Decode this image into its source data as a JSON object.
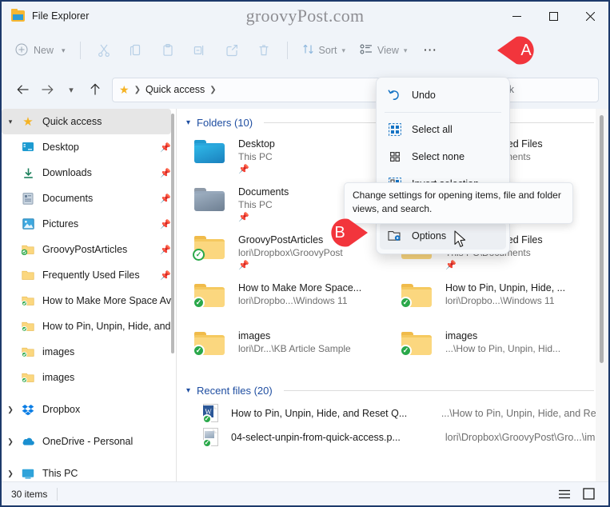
{
  "window": {
    "title": "File Explorer",
    "watermark": "groovyPost.com",
    "controls": {
      "minimize": "Minimize",
      "maximize": "Maximize",
      "close": "Close"
    }
  },
  "toolbar": {
    "new_label": "New",
    "cut_label": "Cut",
    "copy_label": "Copy",
    "paste_label": "Paste",
    "rename_label": "Rename",
    "share_label": "Share",
    "delete_label": "Delete",
    "sort_label": "Sort",
    "view_label": "View",
    "more_label": "See more"
  },
  "nav": {
    "back": "Back",
    "forward": "Forward",
    "recent": "Recent locations",
    "up": "Up",
    "breadcrumb": "Quick access",
    "refresh": "Refresh",
    "search_placeholder": "Search Quick"
  },
  "sidebar": {
    "items": [
      {
        "label": "Quick access",
        "icon": "star-icon",
        "selected": true,
        "expandable": true,
        "expanded": true,
        "pinned": false
      },
      {
        "label": "Desktop",
        "icon": "desktop-icon",
        "selected": false,
        "expandable": false,
        "pinned": true
      },
      {
        "label": "Downloads",
        "icon": "downloads-icon",
        "selected": false,
        "expandable": false,
        "pinned": true
      },
      {
        "label": "Documents",
        "icon": "documents-icon",
        "selected": false,
        "expandable": false,
        "pinned": true
      },
      {
        "label": "Pictures",
        "icon": "pictures-icon",
        "selected": false,
        "expandable": false,
        "pinned": true
      },
      {
        "label": "GroovyPostArticles",
        "icon": "folder-sync-icon",
        "selected": false,
        "expandable": false,
        "pinned": true
      },
      {
        "label": "Frequently Used Files",
        "icon": "folder-icon",
        "selected": false,
        "expandable": false,
        "pinned": true
      },
      {
        "label": "How to Make More Space Av",
        "icon": "folder-sync-icon",
        "selected": false,
        "expandable": false,
        "pinned": false
      },
      {
        "label": "How to Pin, Unpin, Hide, and",
        "icon": "folder-sync-icon",
        "selected": false,
        "expandable": false,
        "pinned": false
      },
      {
        "label": "images",
        "icon": "folder-sync-icon",
        "selected": false,
        "expandable": false,
        "pinned": false
      },
      {
        "label": "images",
        "icon": "folder-sync-icon",
        "selected": false,
        "expandable": false,
        "pinned": false
      },
      {
        "label": "Dropbox",
        "icon": "dropbox-icon",
        "selected": false,
        "expandable": true,
        "expanded": false,
        "pinned": false
      },
      {
        "label": "OneDrive - Personal",
        "icon": "onedrive-icon",
        "selected": false,
        "expandable": true,
        "expanded": false,
        "pinned": false
      },
      {
        "label": "This PC",
        "icon": "thispc-icon",
        "selected": false,
        "expandable": true,
        "expanded": false,
        "pinned": false
      }
    ]
  },
  "content": {
    "folders_group": "Folders (10)",
    "recent_group": "Recent files (20)",
    "folders": [
      {
        "name": "Desktop",
        "path": "This PC",
        "icon": "folder-blue-icon",
        "pinned": true,
        "sync": "none"
      },
      {
        "name": "Frequently Used Files",
        "path": "This PC\\Documents",
        "icon": "folder-icon",
        "pinned": true,
        "sync": "none"
      },
      {
        "name": "Documents",
        "path": "This PC",
        "icon": "folder-grey-icon",
        "pinned": true,
        "sync": "none"
      },
      {
        "name": "GroovyPostArticles",
        "path": "lori\\Dropbox\\GroovyPost",
        "icon": "folder-icon",
        "pinned": true,
        "sync": "hollow"
      },
      {
        "name": "How to Make More Space...",
        "path": "lori\\Dropbo...\\Windows 11",
        "icon": "folder-icon",
        "pinned": false,
        "sync": "solid"
      },
      {
        "name": "How to Pin, Unpin, Hide, ...",
        "path": "lori\\Dropbo...\\Windows 11",
        "icon": "folder-icon",
        "pinned": false,
        "sync": "solid"
      },
      {
        "name": "images",
        "path": "lori\\Dr...\\KB Article Sample",
        "icon": "folder-icon",
        "pinned": false,
        "sync": "solid"
      },
      {
        "name": "images",
        "path": "...\\How to Pin, Unpin, Hid...",
        "icon": "folder-icon",
        "pinned": false,
        "sync": "solid"
      }
    ],
    "recent_files": [
      {
        "name": "How to Pin, Unpin, Hide, and Reset Q...",
        "path": "...\\How to Pin, Unpin, Hide, and Reset ...",
        "icon": "word-doc-icon"
      },
      {
        "name": "04-select-unpin-from-quick-access.p...",
        "path": "lori\\Dropbox\\GroovyPost\\Gro...\\images",
        "icon": "image-file-icon"
      }
    ]
  },
  "menu": {
    "top_items": [
      {
        "label": "Undo",
        "icon": "undo-icon"
      }
    ],
    "items": [
      {
        "label": "Select all",
        "icon": "select-all-icon"
      },
      {
        "label": "Select none",
        "icon": "select-none-icon"
      },
      {
        "label": "Invert selection",
        "icon": "invert-selection-icon"
      },
      {
        "label": "Options",
        "icon": "options-icon"
      }
    ],
    "options_label": "Options",
    "tooltip": "Change settings for opening items, file and folder views, and search."
  },
  "statusbar": {
    "item_count": "30 items",
    "details_view": "Details view",
    "large_icons_view": "Large icons view"
  },
  "callouts": [
    {
      "id": "A",
      "label": "A",
      "color": "#f2353c"
    },
    {
      "id": "B",
      "label": "B",
      "color": "#f2353c"
    }
  ]
}
